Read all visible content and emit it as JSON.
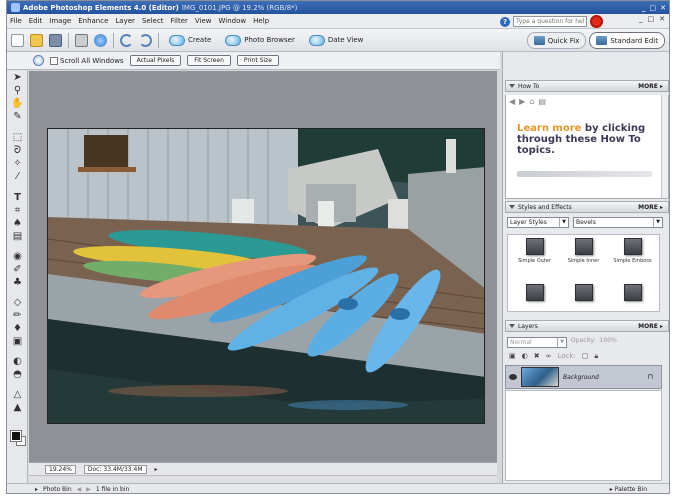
{
  "app": {
    "title": "Adobe Photoshop Elements 4.0 (Editor)",
    "document": "IMG_0101.JPG @ 19.2% (RGB/8*)",
    "window_controls": [
      "_",
      "□",
      "✕"
    ]
  },
  "menu": {
    "items": [
      "File",
      "Edit",
      "Image",
      "Enhance",
      "Layer",
      "Select",
      "Filter",
      "View",
      "Window",
      "Help"
    ],
    "help_placeholder": "Type a question for help",
    "controls": [
      "_",
      "□",
      "✕"
    ]
  },
  "shortcuts": {
    "create": "Create",
    "photo_browser": "Photo Browser",
    "date_view": "Date View"
  },
  "modes": {
    "quick_fix": "Quick Fix",
    "standard_edit": "Standard Edit",
    "active": "standard_edit"
  },
  "options": {
    "scroll_all": "Scroll All Windows",
    "actual_pixels": "Actual Pixels",
    "fit_screen": "Fit Screen",
    "print_size": "Print Size"
  },
  "tools": [
    "move",
    "zoom",
    "hand",
    "eyedropper",
    "marquee",
    "lasso",
    "magic-wand",
    "selection-brush",
    "type",
    "crop",
    "cookie-cutter",
    "straighten",
    "red-eye",
    "healing",
    "clone",
    "eraser",
    "pencil",
    "brush",
    "paint-bucket",
    "gradient",
    "shape",
    "blur",
    "sponge"
  ],
  "status": {
    "zoom": "19.24%",
    "doc_size": "Doc: 33.4M/33.4M"
  },
  "bottom": {
    "photo_bin": "Photo Bin",
    "files_in_bin": "1 file in bin",
    "palette_bin": "Palette Bin"
  },
  "palettes": {
    "how_to": {
      "title": "How To",
      "more": "MORE ▸",
      "lead": "Learn more",
      "text": " by clicking through these How To topics."
    },
    "styles": {
      "title": "Styles and Effects",
      "more": "MORE ▸",
      "category": "Layer Styles",
      "library": "Bevels",
      "items": [
        "Simple Outer",
        "Simple Inner",
        "Simple Emboss",
        "",
        "",
        ""
      ]
    },
    "layers": {
      "title": "Layers",
      "more": "MORE ▸",
      "blend_mode": "Normal",
      "opacity_label": "Opacity:",
      "opacity": "100%",
      "lock_label": "Lock:",
      "layer_name": "Background"
    }
  },
  "colors": {
    "title_bar": "#2f5fa9",
    "help_go": "#e12a1a",
    "how_to_lead": "#e4972a",
    "how_to_text": "#3a3a56"
  }
}
